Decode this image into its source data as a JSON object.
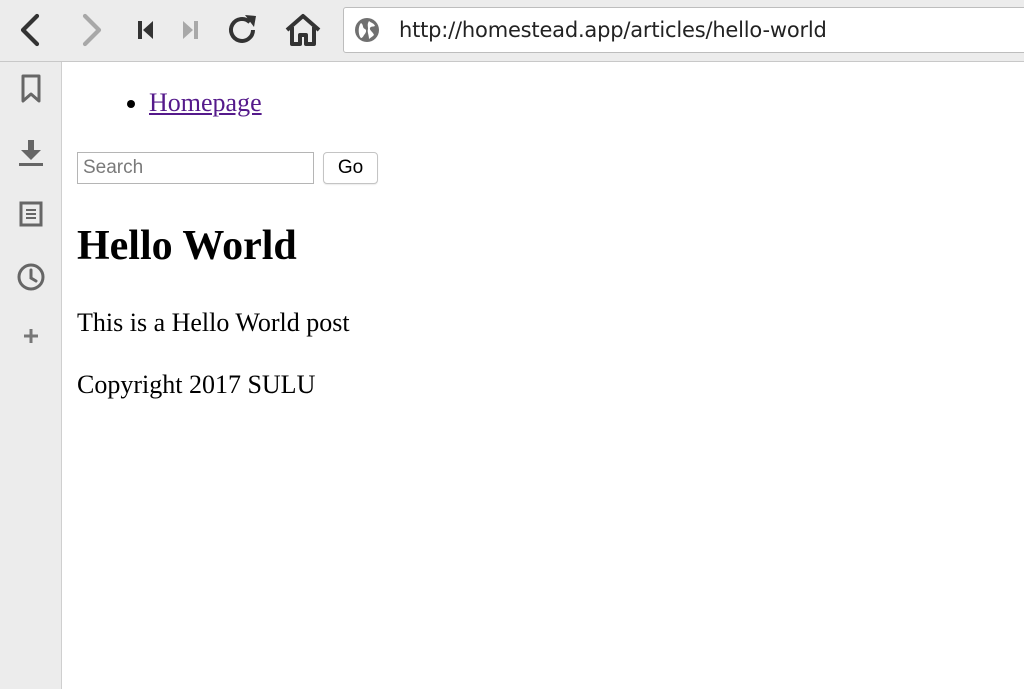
{
  "browser": {
    "url": "http://homestead.app/articles/hello-world",
    "toolbar_icons": [
      "back-icon",
      "forward-icon",
      "first-icon",
      "last-icon",
      "reload-icon",
      "home-icon",
      "globe-icon"
    ]
  },
  "sidebar": {
    "icons": [
      "bookmark-icon",
      "download-icon",
      "notes-icon",
      "history-icon",
      "add-icon"
    ]
  },
  "page": {
    "nav": {
      "items": [
        {
          "label": "Homepage"
        }
      ]
    },
    "search": {
      "placeholder": "Search",
      "value": "",
      "button_label": "Go"
    },
    "title": "Hello World",
    "body": "This is a Hello World post",
    "footer": "Copyright 2017 SULU"
  },
  "colors": {
    "chrome": "#ececec",
    "link_visited": "#551a8b",
    "icon_dark": "#333333",
    "icon_disabled": "#a8a8a8",
    "sidebar_icon": "#666666"
  }
}
